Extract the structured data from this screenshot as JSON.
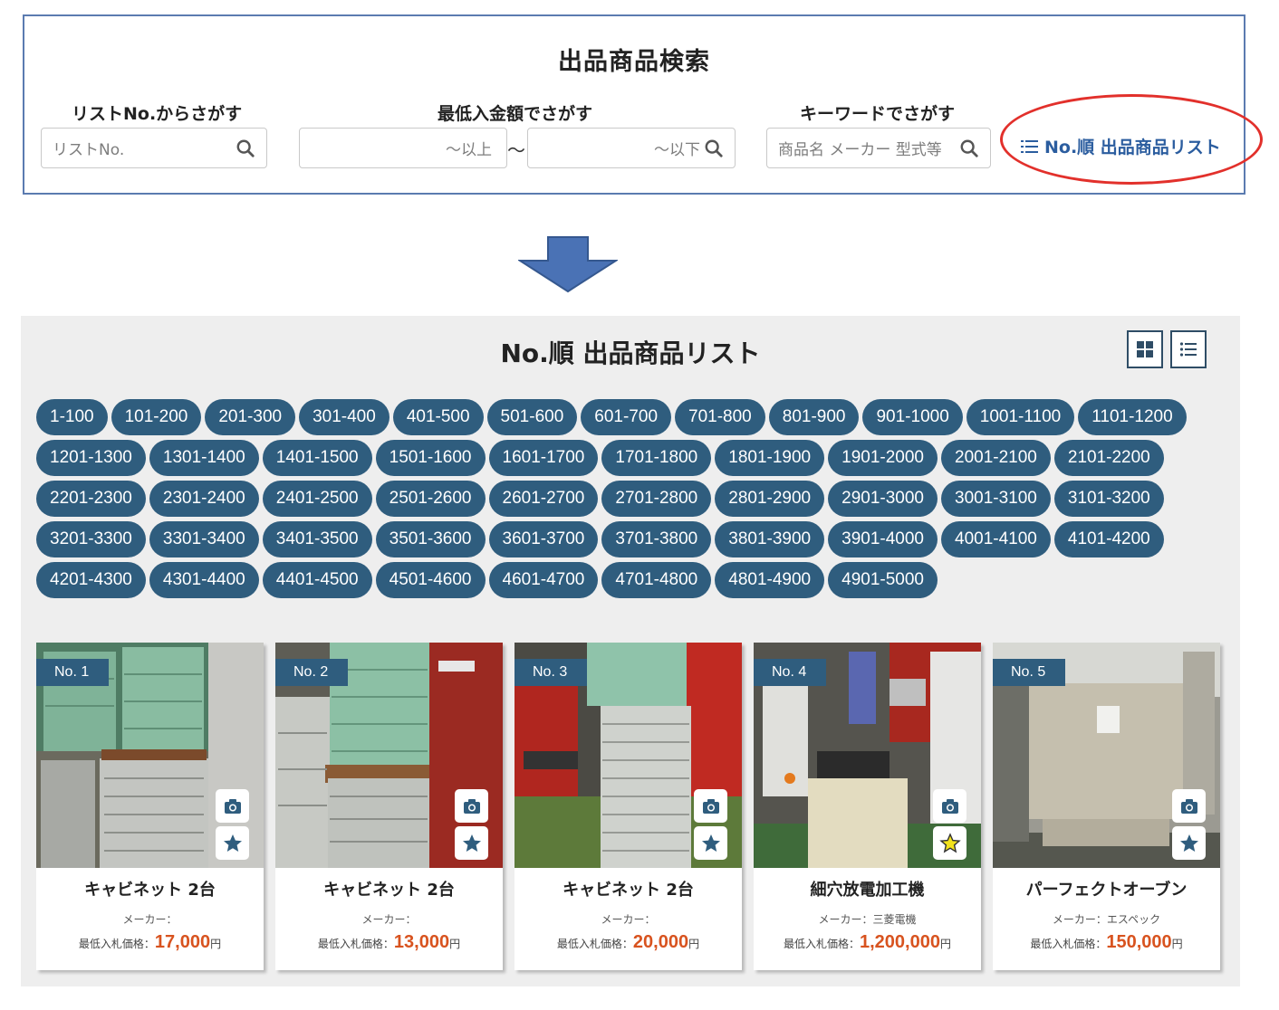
{
  "search": {
    "title": "出品商品検索",
    "list_no": {
      "label": "リストNo.からさがす",
      "placeholder": "リストNo."
    },
    "price": {
      "label": "最低入金額でさがす",
      "min_placeholder": "～以上",
      "separator": "～",
      "max_placeholder": "～以下"
    },
    "keyword": {
      "label": "キーワードでさがす",
      "placeholder": "商品名 メーカー 型式等"
    },
    "list_link": "No.順 出品商品リスト"
  },
  "list": {
    "title": "No.順 出品商品リスト",
    "ranges": [
      "1-100",
      "101-200",
      "201-300",
      "301-400",
      "401-500",
      "501-600",
      "601-700",
      "701-800",
      "801-900",
      "901-1000",
      "1001-1100",
      "1101-1200",
      "1201-1300",
      "1301-1400",
      "1401-1500",
      "1501-1600",
      "1601-1700",
      "1701-1800",
      "1801-1900",
      "1901-2000",
      "2001-2100",
      "2101-2200",
      "2201-2300",
      "2301-2400",
      "2401-2500",
      "2501-2600",
      "2601-2700",
      "2701-2800",
      "2801-2900",
      "2901-3000",
      "3001-3100",
      "3101-3200",
      "3201-3300",
      "3301-3400",
      "3401-3500",
      "3501-3600",
      "3601-3700",
      "3701-3800",
      "3801-3900",
      "3901-4000",
      "4001-4100",
      "4101-4200",
      "4201-4300",
      "4301-4400",
      "4401-4500",
      "4501-4600",
      "4601-4700",
      "4701-4800",
      "4801-4900",
      "4901-5000"
    ],
    "items": [
      {
        "no": "No. 1",
        "name": "キャビネット 2台",
        "maker": "メーカー：",
        "price_label": "最低入札価格：",
        "price": "17,000",
        "yen": "円",
        "favorite": false
      },
      {
        "no": "No. 2",
        "name": "キャビネット 2台",
        "maker": "メーカー：",
        "price_label": "最低入札価格：",
        "price": "13,000",
        "yen": "円",
        "favorite": false
      },
      {
        "no": "No. 3",
        "name": "キャビネット 2台",
        "maker": "メーカー：",
        "price_label": "最低入札価格：",
        "price": "20,000",
        "yen": "円",
        "favorite": false
      },
      {
        "no": "No. 4",
        "name": "細穴放電加工機",
        "maker": "メーカー：三菱電機",
        "price_label": "最低入札価格：",
        "price": "1,200,000",
        "yen": "円",
        "favorite": true
      },
      {
        "no": "No. 5",
        "name": "パーフェクトオーブン",
        "maker": "メーカー：エスペック",
        "price_label": "最低入札価格：",
        "price": "150,000",
        "yen": "円",
        "favorite": false
      }
    ]
  },
  "icons": {
    "search": "magnifier-icon",
    "list": "list-icon",
    "grid_view": "grid-view-icon",
    "list_view": "list-view-icon",
    "camera": "camera-icon",
    "star": "star-icon",
    "arrow": "down-arrow-icon"
  },
  "colors": {
    "panel_border": "#5b7bb0",
    "link": "#2b5d9f",
    "highlight": "#e2302b",
    "pill": "#2f5d7e",
    "price": "#d8531f",
    "arrow": "#4a72b5"
  }
}
